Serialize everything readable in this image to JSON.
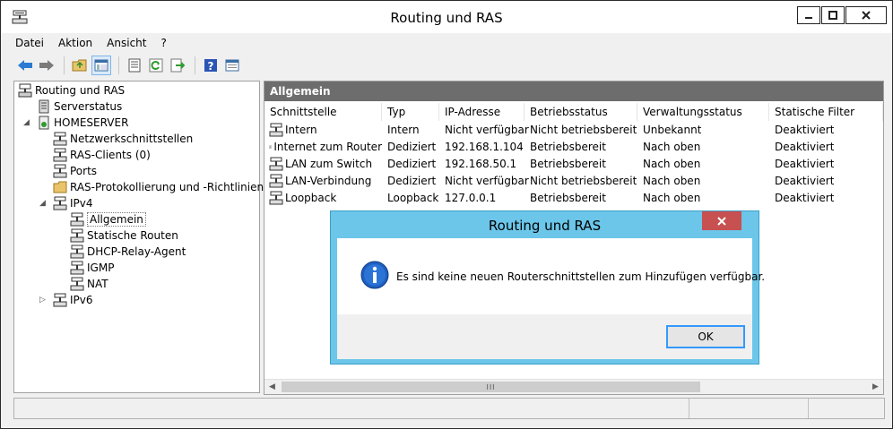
{
  "window": {
    "title": "Routing und RAS"
  },
  "menu": [
    "Datei",
    "Aktion",
    "Ansicht",
    "?"
  ],
  "toolbar": {
    "icons": [
      "back-arrow-icon",
      "forward-arrow-icon",
      "folder-up-icon",
      "show-tree-icon",
      "properties-icon",
      "refresh-icon",
      "export-icon",
      "help-icon",
      "console-icon"
    ]
  },
  "tree": {
    "root": "Routing und RAS",
    "serverstatus": "Serverstatus",
    "server": "HOMESERVER",
    "netz": "Netzwerkschnittstellen",
    "clients": "RAS-Clients (0)",
    "ports": "Ports",
    "logging": "RAS-Protokollierung und -Richtlinien",
    "ipv4": "IPv4",
    "allgemein": "Allgemein",
    "routen": "Statische Routen",
    "dhcp": "DHCP-Relay-Agent",
    "igmp": "IGMP",
    "nat": "NAT",
    "ipv6": "IPv6"
  },
  "detail": {
    "header": "Allgemein",
    "columns": [
      "Schnittstelle",
      "Typ",
      "IP-Adresse",
      "Betriebsstatus",
      "Verwaltungsstatus",
      "Statische Filter"
    ],
    "rows": [
      [
        "Intern",
        "Intern",
        "Nicht verfügbar",
        "Nicht betriebsbereit",
        "Unbekannt",
        "Deaktiviert"
      ],
      [
        "Internet zum Router",
        "Dediziert",
        "192.168.1.104",
        "Betriebsbereit",
        "Nach oben",
        "Deaktiviert"
      ],
      [
        "LAN zum Switch",
        "Dediziert",
        "192.168.50.1",
        "Betriebsbereit",
        "Nach oben",
        "Deaktiviert"
      ],
      [
        "LAN-Verbindung",
        "Dediziert",
        "Nicht verfügbar",
        "Nicht betriebsbereit",
        "Nach oben",
        "Deaktiviert"
      ],
      [
        "Loopback",
        "Loopback",
        "127.0.0.1",
        "Betriebsbereit",
        "Nach oben",
        "Deaktiviert"
      ]
    ]
  },
  "dialog": {
    "title": "Routing und RAS",
    "message": "Es sind keine neuen Routerschnittstellen zum Hinzufügen verfügbar.",
    "ok_label": "OK"
  },
  "colors": {
    "dialog_frame": "#6bc6e9",
    "close_red": "#c75050",
    "header_gray": "#6d6d6d"
  }
}
